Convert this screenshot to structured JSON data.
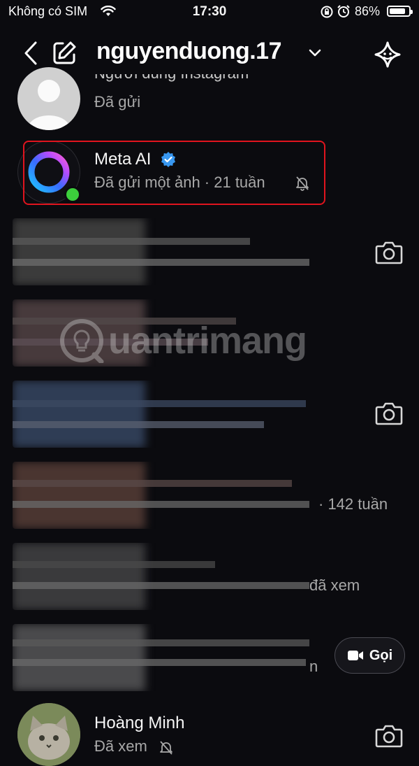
{
  "status_bar": {
    "carrier": "Không có SIM",
    "time": "17:30",
    "battery_pct": "86%",
    "battery_level": 0.86
  },
  "header": {
    "username": "nguyenduong.17"
  },
  "rows": {
    "row0": {
      "name_partial": "Người dùng Instagram",
      "status": "Đã gửi"
    },
    "meta_ai": {
      "name": "Meta AI",
      "status": "Đã gửi một ảnh · 21 tuần"
    },
    "row4": {
      "trailing": "· 142 tuần"
    },
    "row5": {
      "trailing": "đã xem"
    },
    "row6": {
      "trailing": "n",
      "call_label": "Gọi"
    },
    "hoang_minh": {
      "name": "Hoàng Minh",
      "status": "Đã xem"
    }
  },
  "watermark": {
    "text": "uantrimang"
  },
  "colors": {
    "background": "#0b0b0f",
    "highlight": "#e0141e",
    "verified": "#3897f0",
    "online": "#3ccf3c"
  },
  "icons": [
    "back-icon",
    "compose-icon",
    "chevron-down-icon",
    "ai-sparkle-icon",
    "verified-icon",
    "muted-bell-icon",
    "camera-icon",
    "video-call-icon"
  ]
}
